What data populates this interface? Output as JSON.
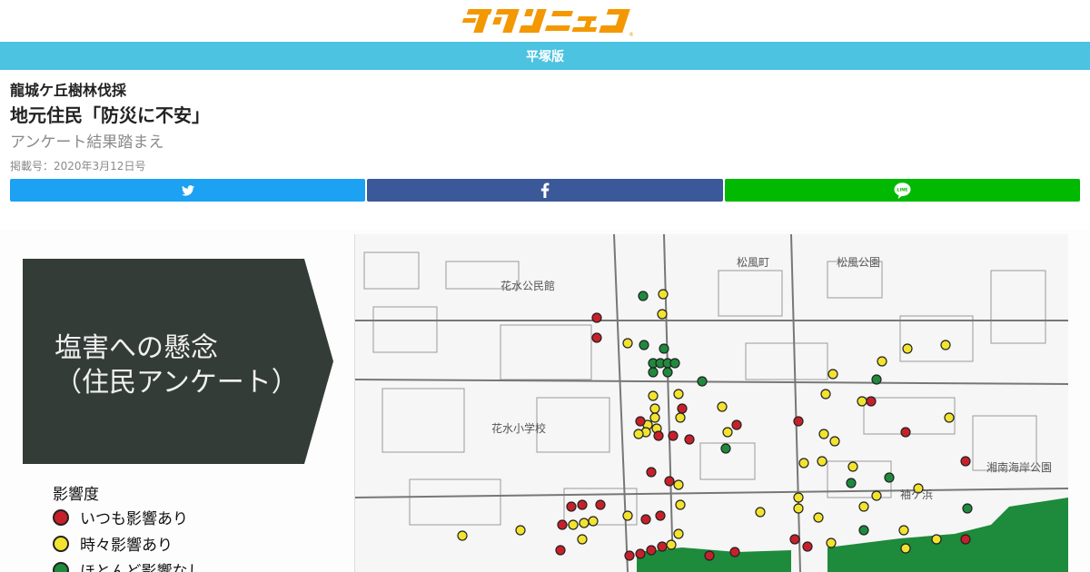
{
  "site": {
    "logo_text": "タウンニュース",
    "edition": "平塚版"
  },
  "article": {
    "kicker": "龍城ケ丘樹林伐採",
    "title": "地元住民「防災に不安」",
    "subtitle": "アンケート結果踏まえ",
    "date": "掲載号：2020年3月12日号"
  },
  "share": {
    "twitter_icon": "twitter-bird-icon",
    "facebook_icon": "facebook-f-icon",
    "line_icon": "line-chat-bubble-icon",
    "colors": {
      "twitter": "#1da1f2",
      "facebook": "#3b5998",
      "line": "#00b900"
    }
  },
  "figure": {
    "panel_line1": "塩害への懸念",
    "panel_line2": "（住民アンケート）",
    "legend_title": "影響度",
    "legend": [
      {
        "label": "いつも影響あり",
        "color": "#c8202a"
      },
      {
        "label": "時々影響あり",
        "color": "#f2e32f"
      },
      {
        "label": "ほとんど影響なし",
        "color": "#1e8a3c"
      }
    ],
    "map_labels": [
      "花水公民館",
      "松風町",
      "松風公園",
      "花水小学校",
      "袖ケ浜",
      "湘南海岸公園"
    ]
  }
}
